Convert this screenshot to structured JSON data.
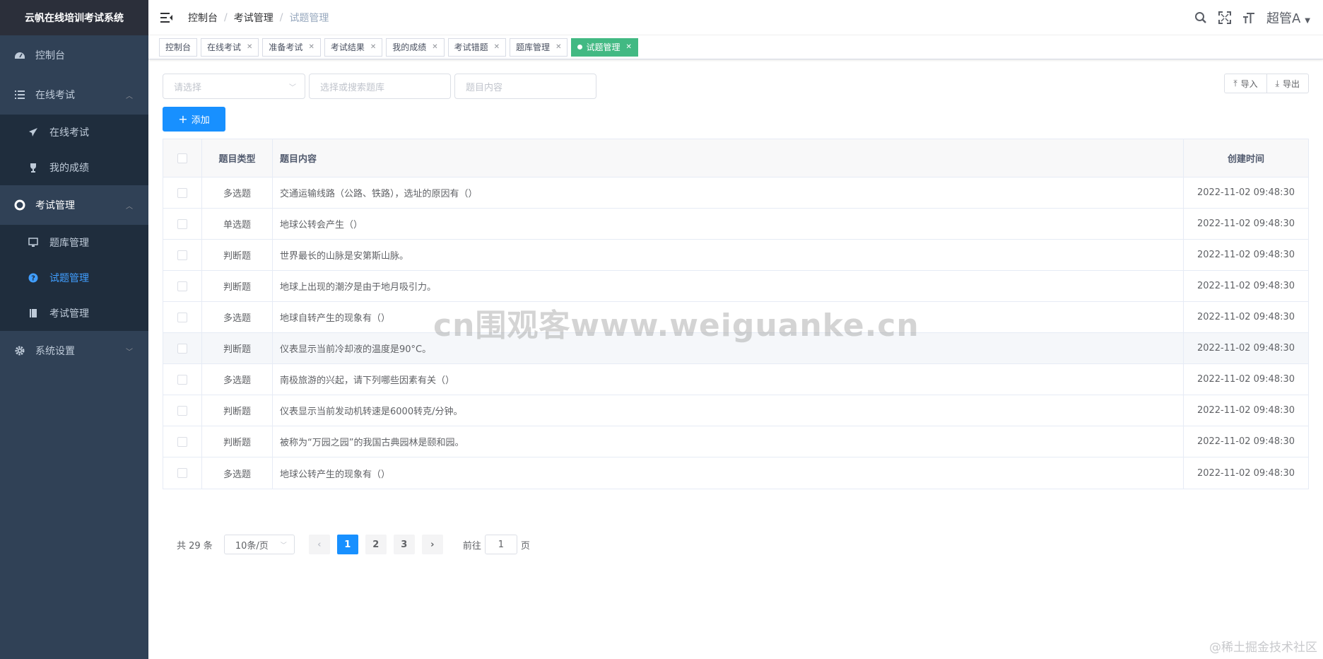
{
  "app": {
    "title": "云帆在线培训考试系统"
  },
  "sidebar": {
    "items": [
      {
        "label": "控制台",
        "icon": "dashboard-icon"
      },
      {
        "label": "在线考试",
        "icon": "list-icon",
        "children": [
          {
            "label": "在线考试",
            "icon": "paper-plane-icon"
          },
          {
            "label": "我的成绩",
            "icon": "trophy-icon"
          }
        ]
      },
      {
        "label": "考试管理",
        "icon": "lifebuoy-icon",
        "children": [
          {
            "label": "题库管理",
            "icon": "monitor-icon"
          },
          {
            "label": "试题管理",
            "icon": "question-circle-icon",
            "active": true
          },
          {
            "label": "考试管理",
            "icon": "book-icon"
          }
        ]
      },
      {
        "label": "系统设置",
        "icon": "gear-icon"
      }
    ]
  },
  "breadcrumb": [
    "控制台",
    "考试管理",
    "试题管理"
  ],
  "navbar": {
    "user": "超管A"
  },
  "tags": [
    {
      "label": "控制台",
      "closable": false
    },
    {
      "label": "在线考试",
      "closable": true
    },
    {
      "label": "准备考试",
      "closable": true
    },
    {
      "label": "考试结果",
      "closable": true
    },
    {
      "label": "我的成绩",
      "closable": true
    },
    {
      "label": "考试错题",
      "closable": true
    },
    {
      "label": "题库管理",
      "closable": true
    },
    {
      "label": "试题管理",
      "closable": true,
      "active": true
    }
  ],
  "filters": {
    "type_placeholder": "请选择",
    "bank_placeholder": "选择或搜索题库",
    "content_placeholder": "题目内容",
    "import_label": "导入",
    "export_label": "导出"
  },
  "add_label": "添加",
  "table": {
    "headers": {
      "type": "题目类型",
      "content": "题目内容",
      "time": "创建时间"
    },
    "rows": [
      {
        "type": "多选题",
        "content": "交通运输线路（公路、铁路），选址的原因有（）",
        "time": "2022-11-02 09:48:30"
      },
      {
        "type": "单选题",
        "content": "地球公转会产生（）",
        "time": "2022-11-02 09:48:30"
      },
      {
        "type": "判断题",
        "content": "世界最长的山脉是安第斯山脉。",
        "time": "2022-11-02 09:48:30"
      },
      {
        "type": "判断题",
        "content": "地球上出现的潮汐是由于地月吸引力。",
        "time": "2022-11-02 09:48:30"
      },
      {
        "type": "多选题",
        "content": "地球自转产生的现象有（）",
        "time": "2022-11-02 09:48:30"
      },
      {
        "type": "判断题",
        "content": "仪表显示当前冷却液的温度是90°C。",
        "time": "2022-11-02 09:48:30"
      },
      {
        "type": "多选题",
        "content": "南极旅游的兴起，请下列哪些因素有关（）",
        "time": "2022-11-02 09:48:30"
      },
      {
        "type": "判断题",
        "content": "仪表显示当前发动机转速是6000转克/分钟。",
        "time": "2022-11-02 09:48:30"
      },
      {
        "type": "判断题",
        "content": "被称为“万园之园”的我国古典园林是颐和园。",
        "time": "2022-11-02 09:48:30"
      },
      {
        "type": "多选题",
        "content": "地球公转产生的现象有（）",
        "time": "2022-11-02 09:48:30"
      }
    ]
  },
  "pagination": {
    "total": "共 29 条",
    "page_size": "10条/页",
    "pages": [
      "1",
      "2",
      "3"
    ],
    "current": "1",
    "goto_prefix": "前往",
    "goto_value": "1",
    "goto_suffix": "页"
  },
  "watermark": "cn围观客www.weiguanke.cn",
  "corner_mark": "@稀土掘金技术社区",
  "colors": {
    "sidebar_bg": "#304156",
    "sidebar_sub_bg": "#1f2d3d",
    "logo_bg": "#2b2f3a",
    "primary": "#1890ff",
    "active_tag": "#42b983",
    "active_menu": "#409eff"
  }
}
